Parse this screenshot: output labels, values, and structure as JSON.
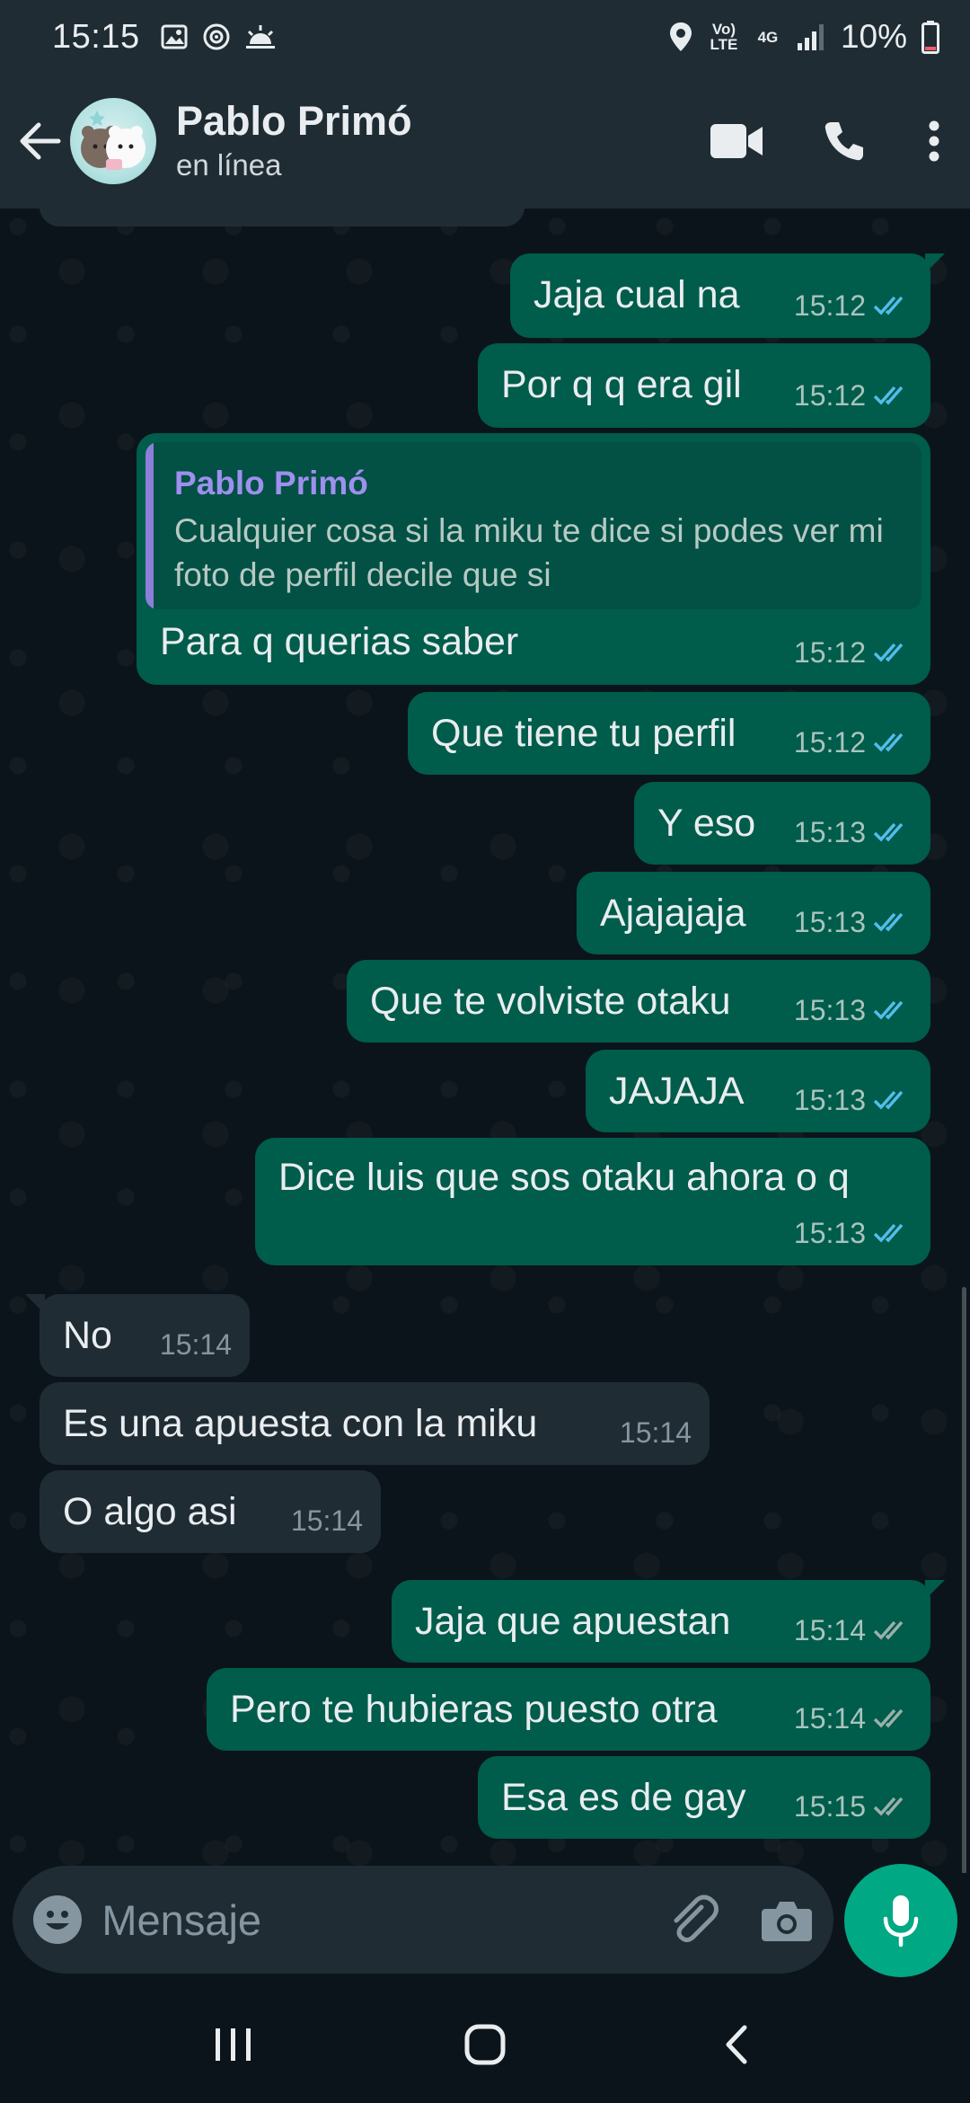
{
  "status_bar": {
    "time": "15:15",
    "volte": "Vo) LTE",
    "network": "4G",
    "battery": "10%"
  },
  "header": {
    "contact_name": "Pablo Primó",
    "contact_status": "en línea"
  },
  "messages": [
    {
      "type": "out",
      "text": "Jaja cual na",
      "time": "15:12",
      "ticks": "read"
    },
    {
      "type": "out",
      "text": "Por q q era gil",
      "time": "15:12",
      "ticks": "read"
    },
    {
      "type": "out",
      "quote_name": "Pablo Primó",
      "quote_text": "Cualquier cosa si la miku te dice si podes ver mi foto de perfil decile que si",
      "text": "Para q querias saber",
      "time": "15:12",
      "ticks": "read"
    },
    {
      "type": "out",
      "text": "Que tiene tu perfil",
      "time": "15:12",
      "ticks": "read"
    },
    {
      "type": "out",
      "text": "Y eso",
      "time": "15:13",
      "ticks": "read"
    },
    {
      "type": "out",
      "text": "Ajajajaja",
      "time": "15:13",
      "ticks": "read"
    },
    {
      "type": "out",
      "text": "Que te volviste otaku",
      "time": "15:13",
      "ticks": "read"
    },
    {
      "type": "out",
      "text": "JAJAJA",
      "time": "15:13",
      "ticks": "read"
    },
    {
      "type": "out",
      "text": "Dice luis que sos otaku ahora o q",
      "time": "15:13",
      "ticks": "read"
    },
    {
      "type": "in",
      "text": "No",
      "time": "15:14"
    },
    {
      "type": "in",
      "text": "Es una apuesta con la miku",
      "time": "15:14"
    },
    {
      "type": "in",
      "text": "O algo asi",
      "time": "15:14"
    },
    {
      "type": "out",
      "text": "Jaja que apuestan",
      "time": "15:14",
      "ticks": "delivered"
    },
    {
      "type": "out",
      "text": "Pero te hubieras puesto otra",
      "time": "15:14",
      "ticks": "delivered"
    },
    {
      "type": "out",
      "text": "Esa es de gay",
      "time": "15:15",
      "ticks": "delivered"
    }
  ],
  "input": {
    "placeholder": "Mensaje"
  },
  "colors": {
    "outgoing_bubble": "#005c4b",
    "incoming_bubble": "#202c33",
    "read_ticks": "#53bdeb",
    "accent": "#00a884"
  }
}
